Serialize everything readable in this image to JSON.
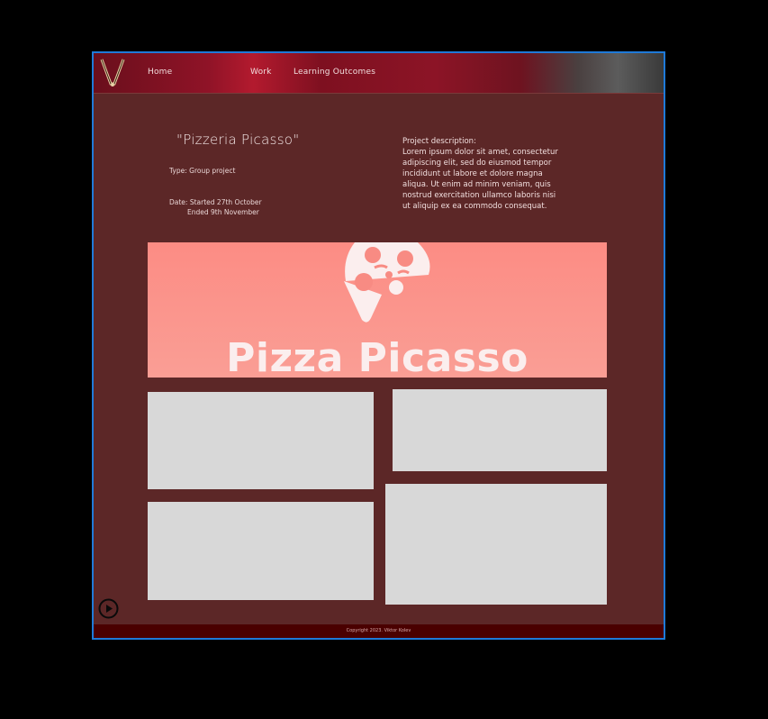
{
  "nav": {
    "home": "Home",
    "work": "Work",
    "learning_outcomes": "Learning Outcomes"
  },
  "project": {
    "title": "\"Pizzeria Picasso\"",
    "type": "Type: Group project",
    "date_line1": "Date: Started 27th October",
    "date_line2": "Ended 9th November",
    "desc_heading": "Project description:",
    "desc_body": "Lorem ipsum dolor sit amet, consectetur adipiscing elit, sed do eiusmod tempor incididunt ut labore et dolore magna aliqua. Ut enim ad minim veniam, quis nostrud exercitation ullamco laboris nisi ut aliquip ex ea commodo consequat."
  },
  "banner": {
    "text": "Pizza Picasso",
    "bg_top": "#fc8c84",
    "bg_bottom": "#fa9e95"
  },
  "footer": {
    "copyright": "Copyright 2023. Viktor Kolev"
  },
  "icons": {
    "logo": "logo-icon",
    "pizza": "pizza-slice-icon",
    "play": "play-icon"
  },
  "colors": {
    "page_bg": "#5c2727",
    "footer_bg": "#4a0000",
    "frame_border": "#1f7ad8"
  }
}
